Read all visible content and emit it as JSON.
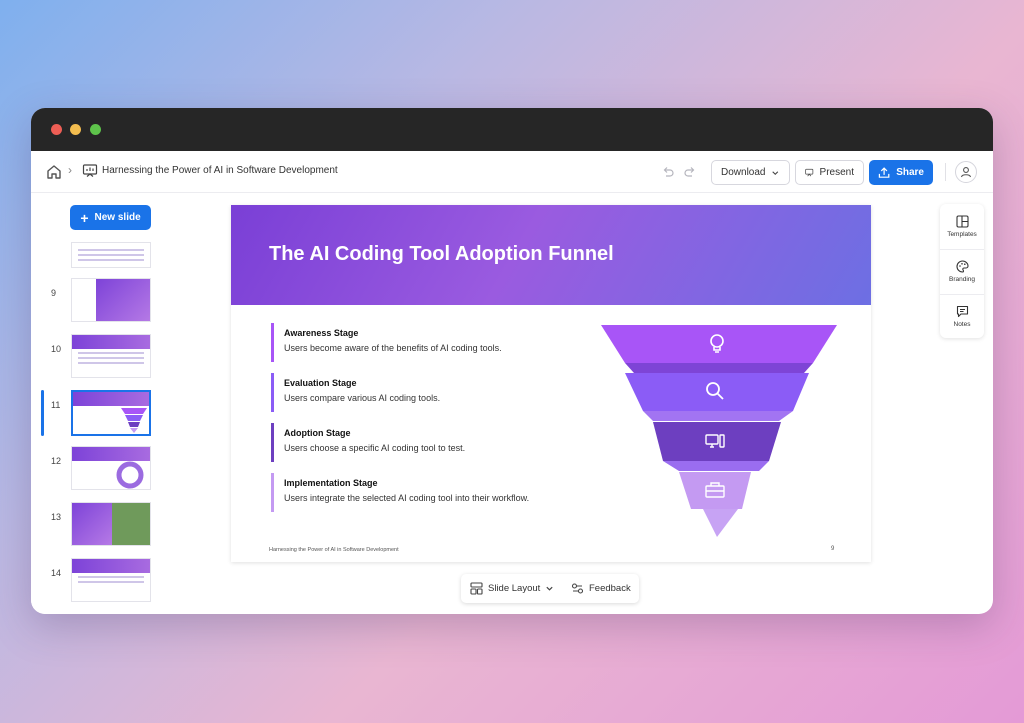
{
  "window": {
    "controls": [
      "close",
      "minimize",
      "maximize"
    ]
  },
  "breadcrumb": {
    "home_icon": "home-icon",
    "doc_icon": "presentation-icon",
    "title": "Harnessing the Power of AI in Software Development"
  },
  "toolbar": {
    "download_label": "Download",
    "present_label": "Present",
    "share_label": "Share"
  },
  "sidebar": {
    "new_slide_label": "New slide",
    "thumbs": [
      {
        "num": "9"
      },
      {
        "num": "10"
      },
      {
        "num": "11",
        "active": true
      },
      {
        "num": "12"
      },
      {
        "num": "13"
      },
      {
        "num": "14"
      }
    ]
  },
  "slide": {
    "title": "The AI Coding Tool Adoption Funnel",
    "stages": [
      {
        "title": "Awareness Stage",
        "desc": "Users become aware of the benefits of AI coding tools.",
        "color": "#a855f7",
        "icon": "lightbulb-icon"
      },
      {
        "title": "Evaluation Stage",
        "desc": "Users compare various AI coding tools.",
        "color": "#8b5cf6",
        "icon": "search-icon"
      },
      {
        "title": "Adoption Stage",
        "desc": "Users choose a specific AI coding tool to test.",
        "color": "#6d3fc0",
        "icon": "computer-icon"
      },
      {
        "title": "Implementation Stage",
        "desc": "Users integrate the selected AI coding tool into their workflow.",
        "color": "#c49af2",
        "icon": "toolbox-icon"
      }
    ],
    "footer": "Harnessing the Power of AI in Software Development",
    "page_number": "9"
  },
  "bottom_bar": {
    "layout_label": "Slide Layout",
    "feedback_label": "Feedback"
  },
  "right_panel": {
    "templates_label": "Templates",
    "branding_label": "Branding",
    "notes_label": "Notes"
  },
  "colors": {
    "accent": "#1a73e8",
    "brand_purple": "#7a3fd6"
  }
}
